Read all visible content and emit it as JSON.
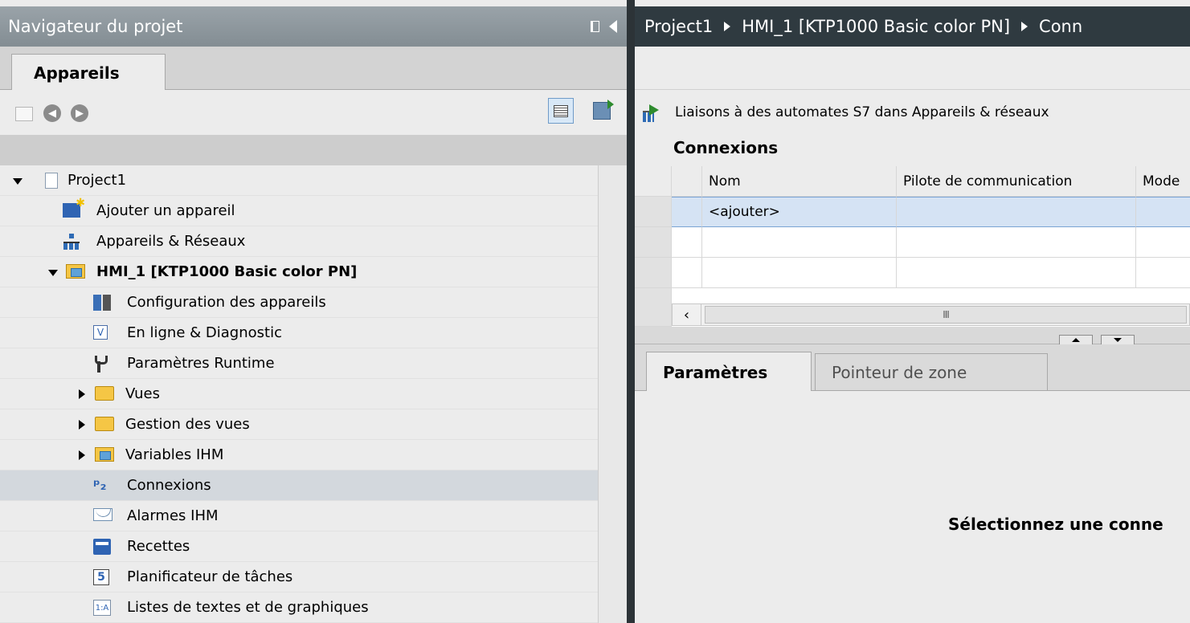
{
  "navigator": {
    "title": "Navigateur du projet",
    "tab": "Appareils"
  },
  "tree": [
    {
      "label": "Project1",
      "name": "tree-item-project1",
      "icon": "page-icon",
      "expander": "open",
      "bold": false,
      "selected": false
    },
    {
      "label": "Ajouter un appareil",
      "name": "tree-item-add-device",
      "icon": "add-device-icon",
      "expander": "none",
      "bold": false,
      "selected": false
    },
    {
      "label": "Appareils & Réseaux",
      "name": "tree-item-devices-networks",
      "icon": "network-icon",
      "expander": "none",
      "bold": false,
      "selected": false
    },
    {
      "label": "HMI_1 [KTP1000 Basic color PN]",
      "name": "tree-item-hmi1",
      "icon": "hmi-folder-icon",
      "expander": "open",
      "bold": true,
      "selected": false
    },
    {
      "label": "Configuration des appareils",
      "name": "tree-item-device-config",
      "icon": "device-config-icon",
      "expander": "none",
      "bold": false,
      "selected": false
    },
    {
      "label": "En ligne & Diagnostic",
      "name": "tree-item-online-diag",
      "icon": "diagnostic-icon",
      "expander": "none",
      "bold": false,
      "selected": false
    },
    {
      "label": "Paramètres Runtime",
      "name": "tree-item-runtime-settings",
      "icon": "wrench-icon",
      "expander": "none",
      "bold": false,
      "selected": false
    },
    {
      "label": "Vues",
      "name": "tree-item-screens",
      "icon": "folder-icon",
      "expander": "closed",
      "bold": false,
      "selected": false
    },
    {
      "label": "Gestion des vues",
      "name": "tree-item-screen-management",
      "icon": "folder-icon",
      "expander": "closed",
      "bold": false,
      "selected": false
    },
    {
      "label": "Variables IHM",
      "name": "tree-item-hmi-tags",
      "icon": "hmi-tags-folder-icon",
      "expander": "closed",
      "bold": false,
      "selected": false
    },
    {
      "label": "Connexions",
      "name": "tree-item-connections",
      "icon": "connections-icon",
      "expander": "none",
      "bold": false,
      "selected": true
    },
    {
      "label": "Alarmes IHM",
      "name": "tree-item-hmi-alarms",
      "icon": "mail-icon",
      "expander": "none",
      "bold": false,
      "selected": false
    },
    {
      "label": "Recettes",
      "name": "tree-item-recipes",
      "icon": "recipe-icon",
      "expander": "none",
      "bold": false,
      "selected": false
    },
    {
      "label": "Planificateur de tâches",
      "name": "tree-item-scheduler",
      "icon": "scheduler-icon",
      "expander": "none",
      "bold": false,
      "selected": false
    },
    {
      "label": "Listes de textes et de graphiques",
      "name": "tree-item-text-graphic-lists",
      "icon": "lists-icon",
      "expander": "none",
      "bold": false,
      "selected": false
    }
  ],
  "breadcrumb": [
    "Project1",
    "HMI_1 [KTP1000 Basic color PN]",
    "Conn"
  ],
  "link_text": "Liaisons à des automates S7 dans Appareils & réseaux",
  "connections": {
    "title": "Connexions",
    "columns": [
      "Nom",
      "Pilote de communication",
      "Mode"
    ],
    "rows": [
      [
        "<ajouter>",
        "",
        ""
      ],
      [
        "",
        "",
        ""
      ],
      [
        "",
        "",
        ""
      ]
    ]
  },
  "scrollbar_glyph": "III",
  "panel_tabs": {
    "params": "Paramètres",
    "zone": "Pointeur de zone"
  },
  "select_message": "Sélectionnez une conne",
  "schedule_icon_text": "5",
  "colors": {
    "title_bar": "#8a949a",
    "breadcrumb_bar": "#2f3a40",
    "selection_blue": "#d5e3f4"
  }
}
